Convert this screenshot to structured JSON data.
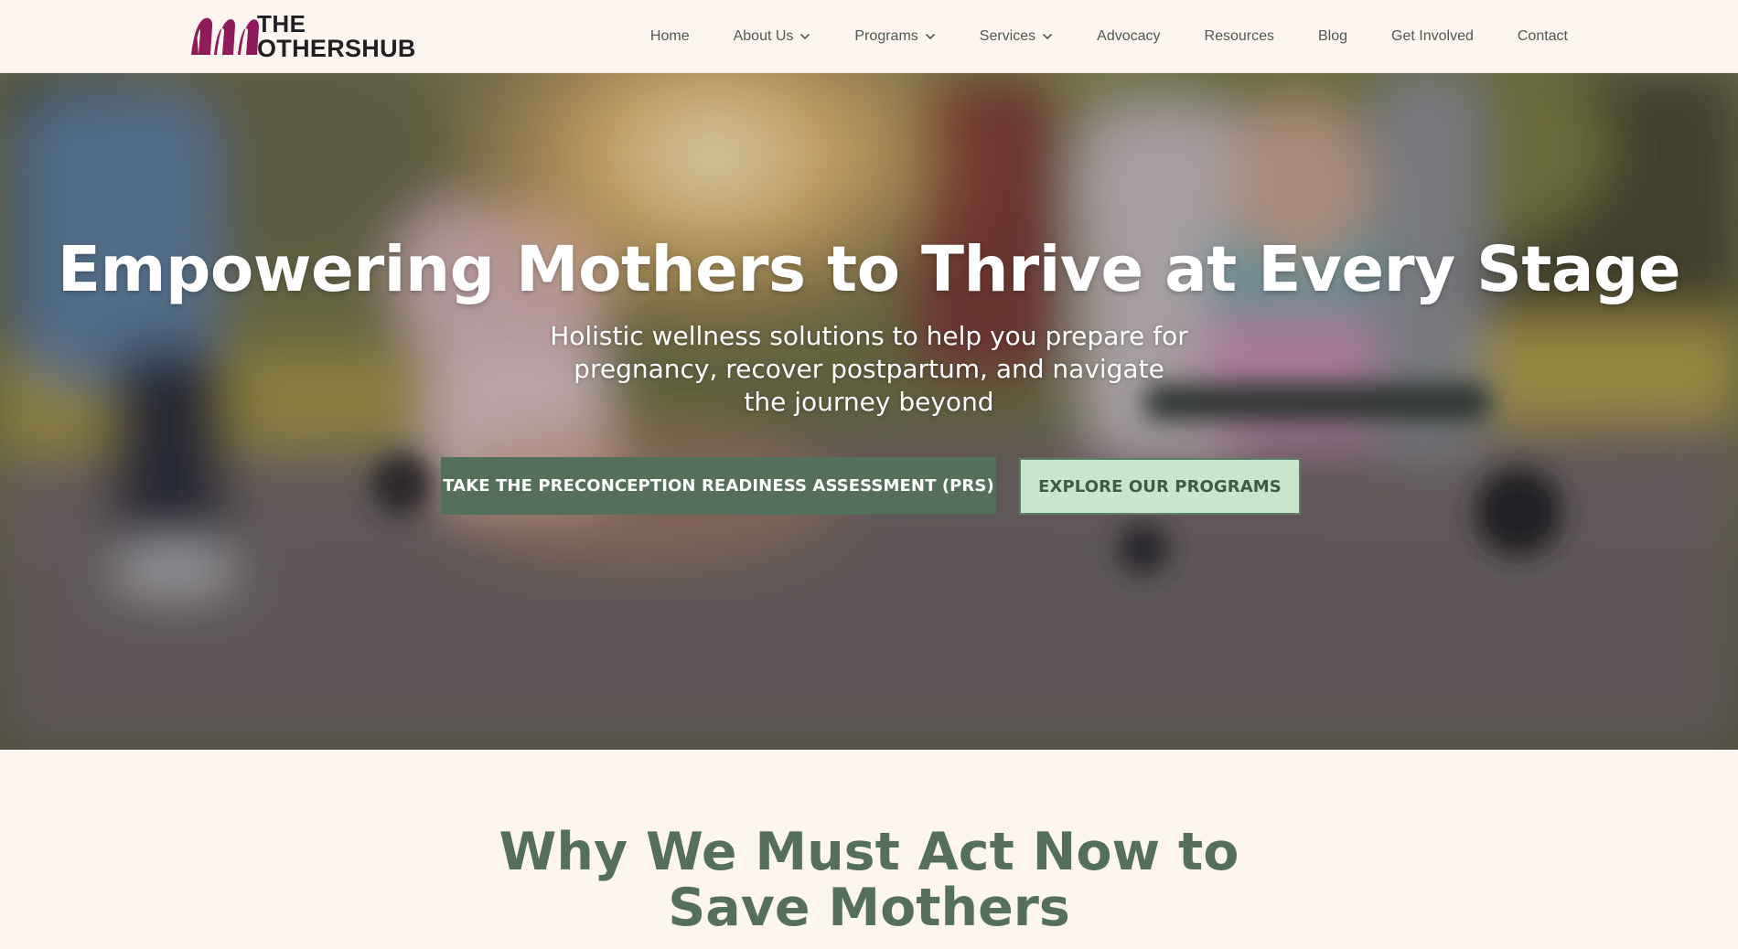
{
  "header": {
    "logo": {
      "line1": "THE",
      "line2": "OTHERSHUB",
      "mark_color": "#8e1b5a"
    },
    "nav": [
      {
        "label": "Home",
        "has_dropdown": false
      },
      {
        "label": "About Us",
        "has_dropdown": true
      },
      {
        "label": "Programs",
        "has_dropdown": true
      },
      {
        "label": "Services",
        "has_dropdown": true
      },
      {
        "label": "Advocacy",
        "has_dropdown": false
      },
      {
        "label": "Resources",
        "has_dropdown": false
      },
      {
        "label": "Blog",
        "has_dropdown": false
      },
      {
        "label": "Get Involved",
        "has_dropdown": false
      },
      {
        "label": "Contact",
        "has_dropdown": false
      }
    ]
  },
  "hero": {
    "title": "Empowering Mothers to Thrive at Every Stage",
    "subtitle": "Holistic wellness solutions to help you prepare for pregnancy, recover postpartum, and navigate the journey beyond",
    "primary_button": "TAKE THE PRECONCEPTION READINESS ASSESSMENT (PRS)",
    "secondary_button": "EXPLORE OUR PROGRAMS"
  },
  "why": {
    "title_line1": "Why We Must Act Now to",
    "title_line2": "Save Mothers"
  },
  "colors": {
    "page_bg": "#fdf6f0",
    "nav_text": "#4e5a4f",
    "brand_green": "#55705a",
    "mint": "#c7e7cd",
    "logo_magenta": "#8e1b5a"
  }
}
